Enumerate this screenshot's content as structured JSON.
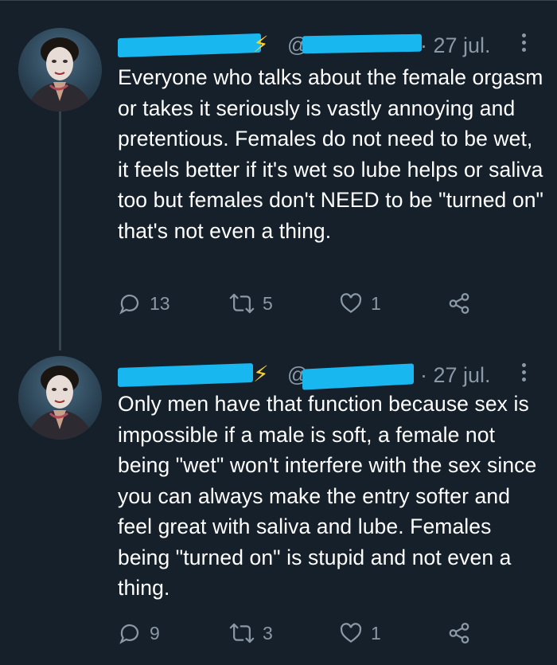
{
  "tweets": [
    {
      "date": "· 27 jul.",
      "handle_prefix": "@",
      "text": "Everyone who talks about the female orgasm or takes it seriously is vastly annoying and pretentious. Females do not need to be wet, it feels better if it's wet so lube helps or saliva too but females don't NEED to be \"turned on\" that's not even a thing.",
      "replies": "13",
      "retweets": "5",
      "likes": "1"
    },
    {
      "date": "· 27 jul.",
      "handle_prefix": "@",
      "text": "Only men have that function because sex is impossible if a male is soft, a female not being \"wet\" won't interfere with the sex since you can always make the entry softer and feel great with saliva and lube. Females being \"turned on\" is stupid and not even a thing.",
      "replies": "9",
      "retweets": "3",
      "likes": "1"
    }
  ],
  "colors": {
    "background": "#15202b",
    "secondary_text": "#8b98a5",
    "redaction": "#18b7ef",
    "verified_bolt": "#f7d038"
  },
  "icons": {
    "reply": "speech-bubble-icon",
    "retweet": "retweet-icon",
    "like": "heart-icon",
    "share": "share-icon",
    "more": "more-vertical-icon",
    "badge": "lightning-bolt-icon"
  }
}
